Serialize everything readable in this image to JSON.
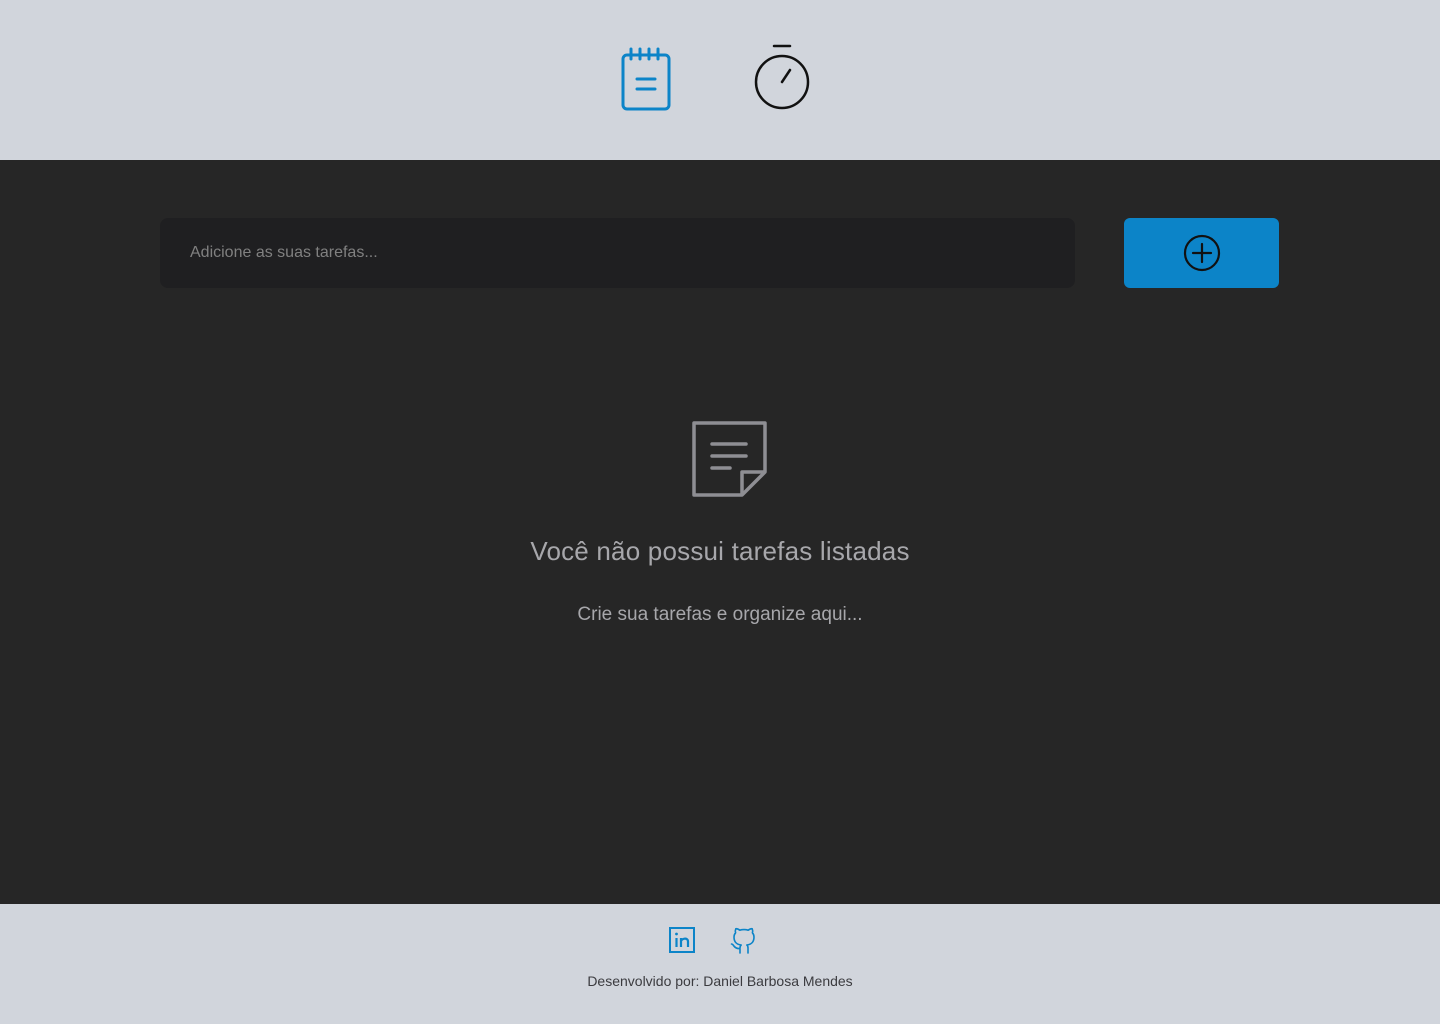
{
  "header": {
    "nav": [
      {
        "icon": "notepad-icon",
        "label": "Notes",
        "active": true
      },
      {
        "icon": "timer-icon",
        "label": "Timer",
        "active": false
      }
    ]
  },
  "task_form": {
    "placeholder": "Adicione as suas tarefas...",
    "value": "",
    "add_button_icon": "plus-circle-icon"
  },
  "empty_state": {
    "icon": "note-icon",
    "title": "Você não possui tarefas listadas",
    "subtitle": "Crie sua tarefas e organize aqui..."
  },
  "footer": {
    "links": [
      {
        "icon": "linkedin-icon"
      },
      {
        "icon": "github-icon"
      }
    ],
    "credits": "Desenvolvido por: Daniel Barbosa Mendes"
  },
  "colors": {
    "accent": "#0c84c8",
    "header_bg": "#d1d5dc",
    "main_bg": "#262626",
    "input_bg": "#1f1f21",
    "muted_text": "#a7a7ab"
  }
}
